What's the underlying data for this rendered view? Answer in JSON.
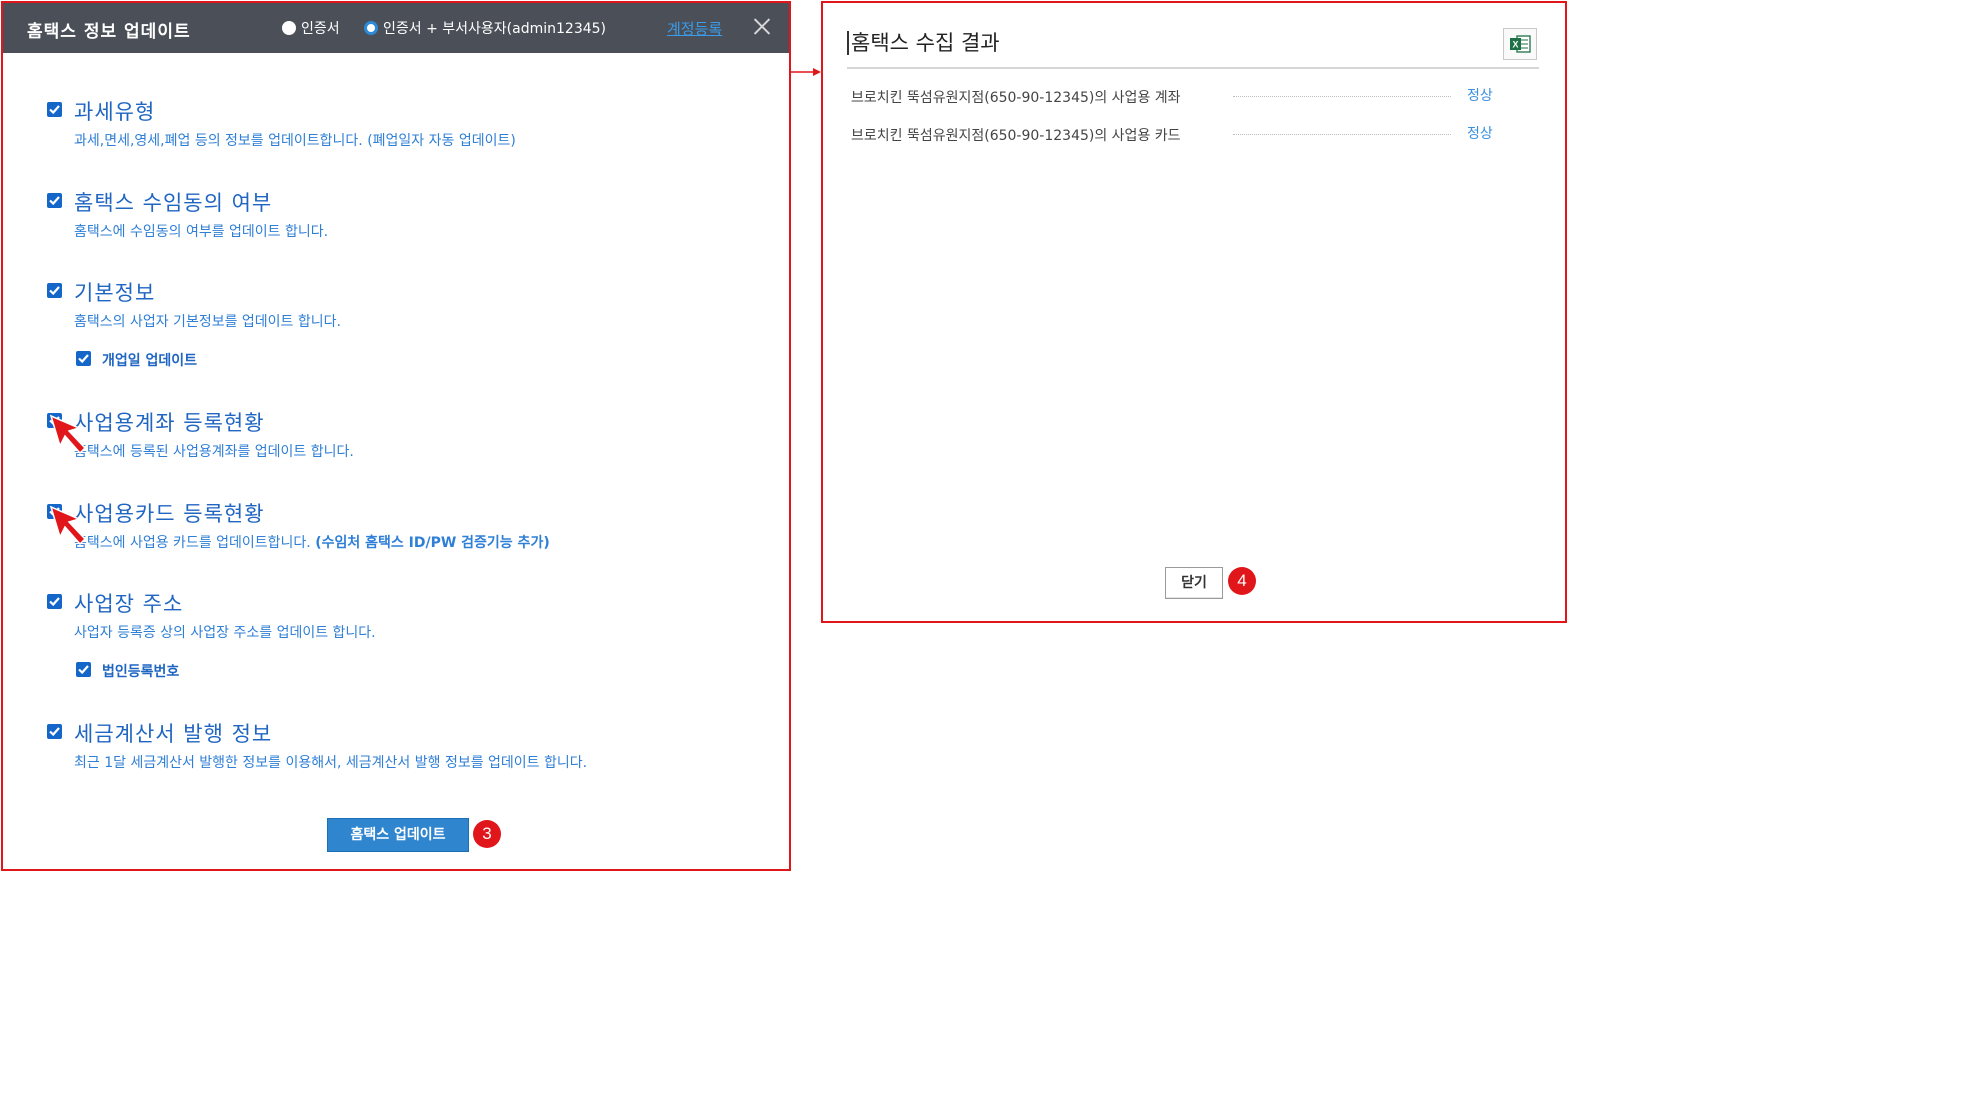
{
  "left_dialog": {
    "title": "홈택스 정보 업데이트",
    "radio_options": [
      {
        "label": "인증서",
        "selected": false
      },
      {
        "label": "인증서 + 부서사용자(admin12345)",
        "selected": true
      }
    ],
    "account_link": "계정등록",
    "options": [
      {
        "title": "과세유형",
        "desc": "과세,면세,영세,폐업 등의 정보를 업데이트합니다. (폐업일자 자동 업데이트)",
        "checked": true
      },
      {
        "title": "홈택스 수임동의 여부",
        "desc": "홈택스에 수임동의 여부를 업데이트 합니다.",
        "checked": true
      },
      {
        "title": "기본정보",
        "desc": "홈택스의 사업자 기본정보를 업데이트 합니다.",
        "checked": true
      },
      {
        "title": "사업용계좌 등록현황",
        "desc": "홈택스에 등록된 사업용계좌를 업데이트 합니다.",
        "checked": true
      },
      {
        "title": "사업용카드 등록현황",
        "desc": "홈택스에 사업용 카드를 업데이트합니다.",
        "desc_bold": "(수임처 홈택스 ID/PW 검증기능 추가)",
        "checked": true
      },
      {
        "title": "사업장 주소",
        "desc": "사업자 등록증 상의 사업장 주소를 업데이트 합니다.",
        "checked": true
      },
      {
        "title": "세금계산서 발행 정보",
        "desc": "최근 1달 세금계산서 발행한 정보를 이용해서, 세금계산서 발행 정보를 업데이트 합니다.",
        "checked": true
      }
    ],
    "sub_options": [
      {
        "label": "개업일 업데이트",
        "checked": true
      },
      {
        "label": "법인등록번호",
        "checked": true
      }
    ],
    "update_button": "홈택스 업데이트",
    "step_badge": "3"
  },
  "right_dialog": {
    "title": "홈택스 수집 결과",
    "results": [
      {
        "text": "브로치킨 뚝섬유원지점(650-90-12345)의 사업용 계좌",
        "status": "정상"
      },
      {
        "text": "브로치킨 뚝섬유원지점(650-90-12345)의 사업용 카드",
        "status": "정상"
      }
    ],
    "close_button": "닫기",
    "step_badge": "4"
  },
  "colors": {
    "highlight_border": "#e0161b",
    "header_bg": "#4a4f58",
    "checkbox": "#1466c8",
    "title_text": "#1f65c2",
    "button_bg": "#2f86cf"
  },
  "icons": [
    "close-icon",
    "checkbox-checked-icon",
    "cursor-arrow-icon",
    "excel-icon",
    "connector-arrow-icon"
  ]
}
